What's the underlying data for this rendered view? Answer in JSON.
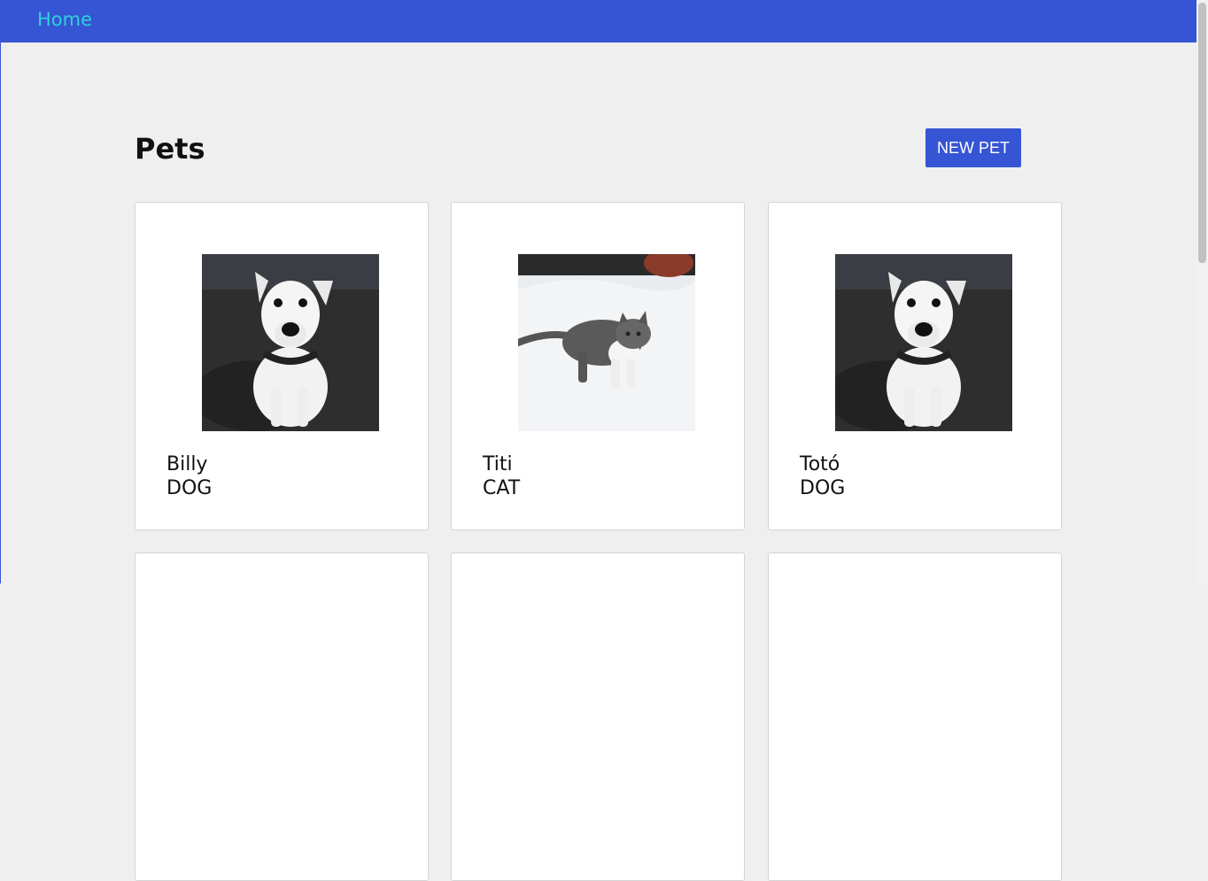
{
  "navbar": {
    "home_label": "Home",
    "color": "#3555d4",
    "link_color": "#30d0d8"
  },
  "main": {
    "title": "Pets",
    "new_pet_label": "NEW PET"
  },
  "pets": [
    {
      "name": "Billy",
      "species": "DOG",
      "photo": "dog-photo"
    },
    {
      "name": "Titi",
      "species": "CAT",
      "photo": "cat-photo"
    },
    {
      "name": "Totó",
      "species": "DOG",
      "photo": "dog-photo"
    }
  ]
}
